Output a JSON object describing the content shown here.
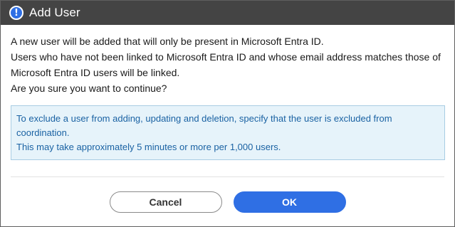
{
  "dialog": {
    "title": "Add User",
    "title_icon": "info-exclamation-icon",
    "message_lines": [
      "A new user will be added that will only be present in Microsoft Entra ID.",
      "Users who have not been linked to Microsoft Entra ID and whose email address matches those of",
      "Microsoft Entra ID users will be linked.",
      "Are you sure you want to continue?"
    ],
    "note_lines": [
      "To exclude a user from adding, updating and deletion, specify that the user is excluded from",
      "coordination.",
      "This may take approximately 5 minutes or more per 1,000 users."
    ],
    "buttons": {
      "cancel_label": "Cancel",
      "ok_label": "OK"
    }
  },
  "colors": {
    "titlebar_bg": "#444444",
    "accent": "#2f6fe4",
    "note_bg": "#e6f3fa",
    "note_text": "#1a62a3"
  }
}
